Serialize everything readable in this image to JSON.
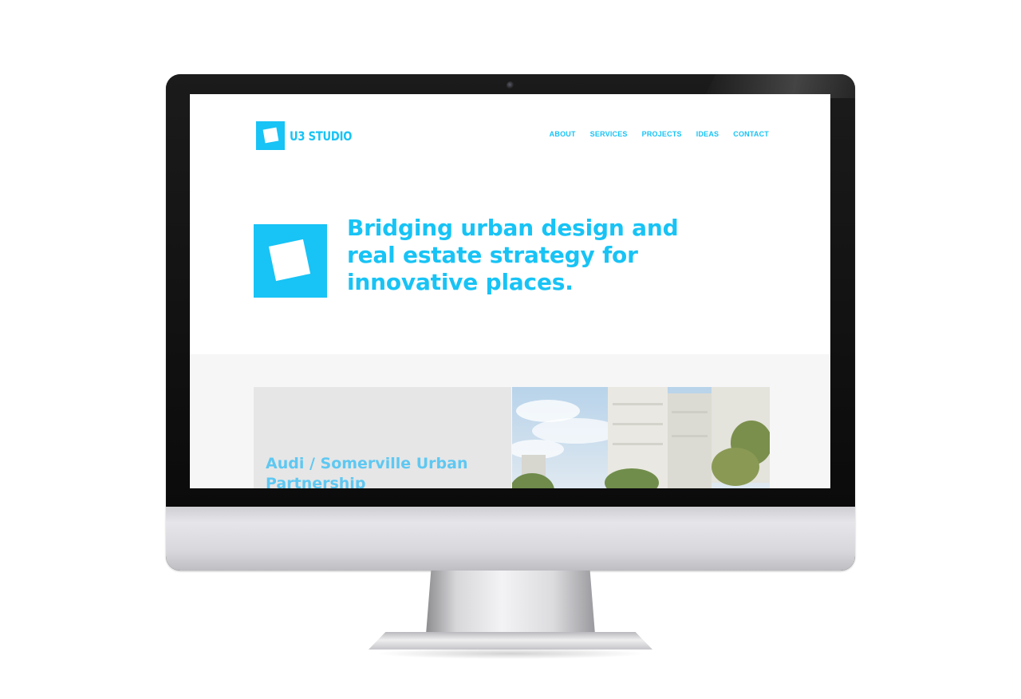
{
  "site": {
    "brand": "U3 STUDIO",
    "nav": [
      "ABOUT",
      "SERVICES",
      "PROJECTS",
      "IDEAS",
      "CONTACT"
    ],
    "hero_title": "Bridging urban design and real estate strategy for innovative places.",
    "featured_project": {
      "title": "Audi / Somerville Urban Partnership"
    }
  },
  "colors": {
    "accent": "#18c3f5",
    "section_bg": "#f6f6f6",
    "card_bg": "#e6e6e6"
  }
}
